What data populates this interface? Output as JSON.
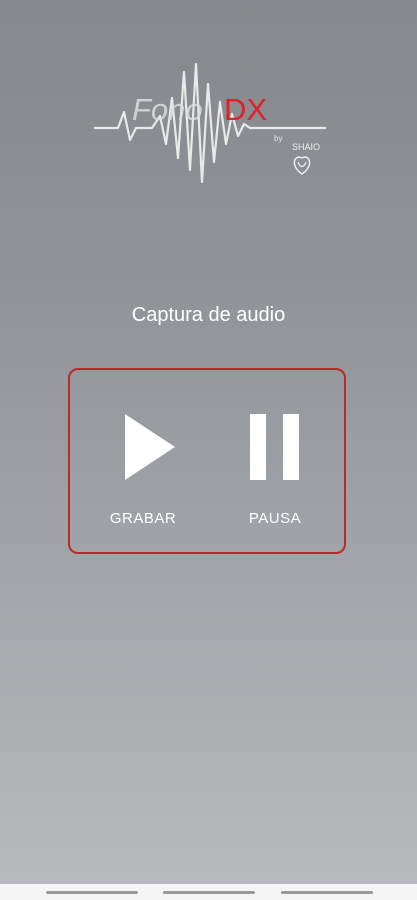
{
  "logo": {
    "name_part1": "Fono",
    "name_part2": "DX",
    "by": "by",
    "org_name": "SHAIO",
    "icon": "heartbeat-waveform",
    "accent_color": "#e0202a"
  },
  "screen": {
    "title": "Captura de audio"
  },
  "controls": {
    "panel_border_color": "#c0272d",
    "record": {
      "icon": "play-icon",
      "label": "GRABAR"
    },
    "pause": {
      "icon": "pause-icon",
      "label": "PAUSA"
    }
  },
  "navigation": {
    "items": [
      "nav-handle",
      "nav-handle",
      "nav-handle"
    ]
  }
}
